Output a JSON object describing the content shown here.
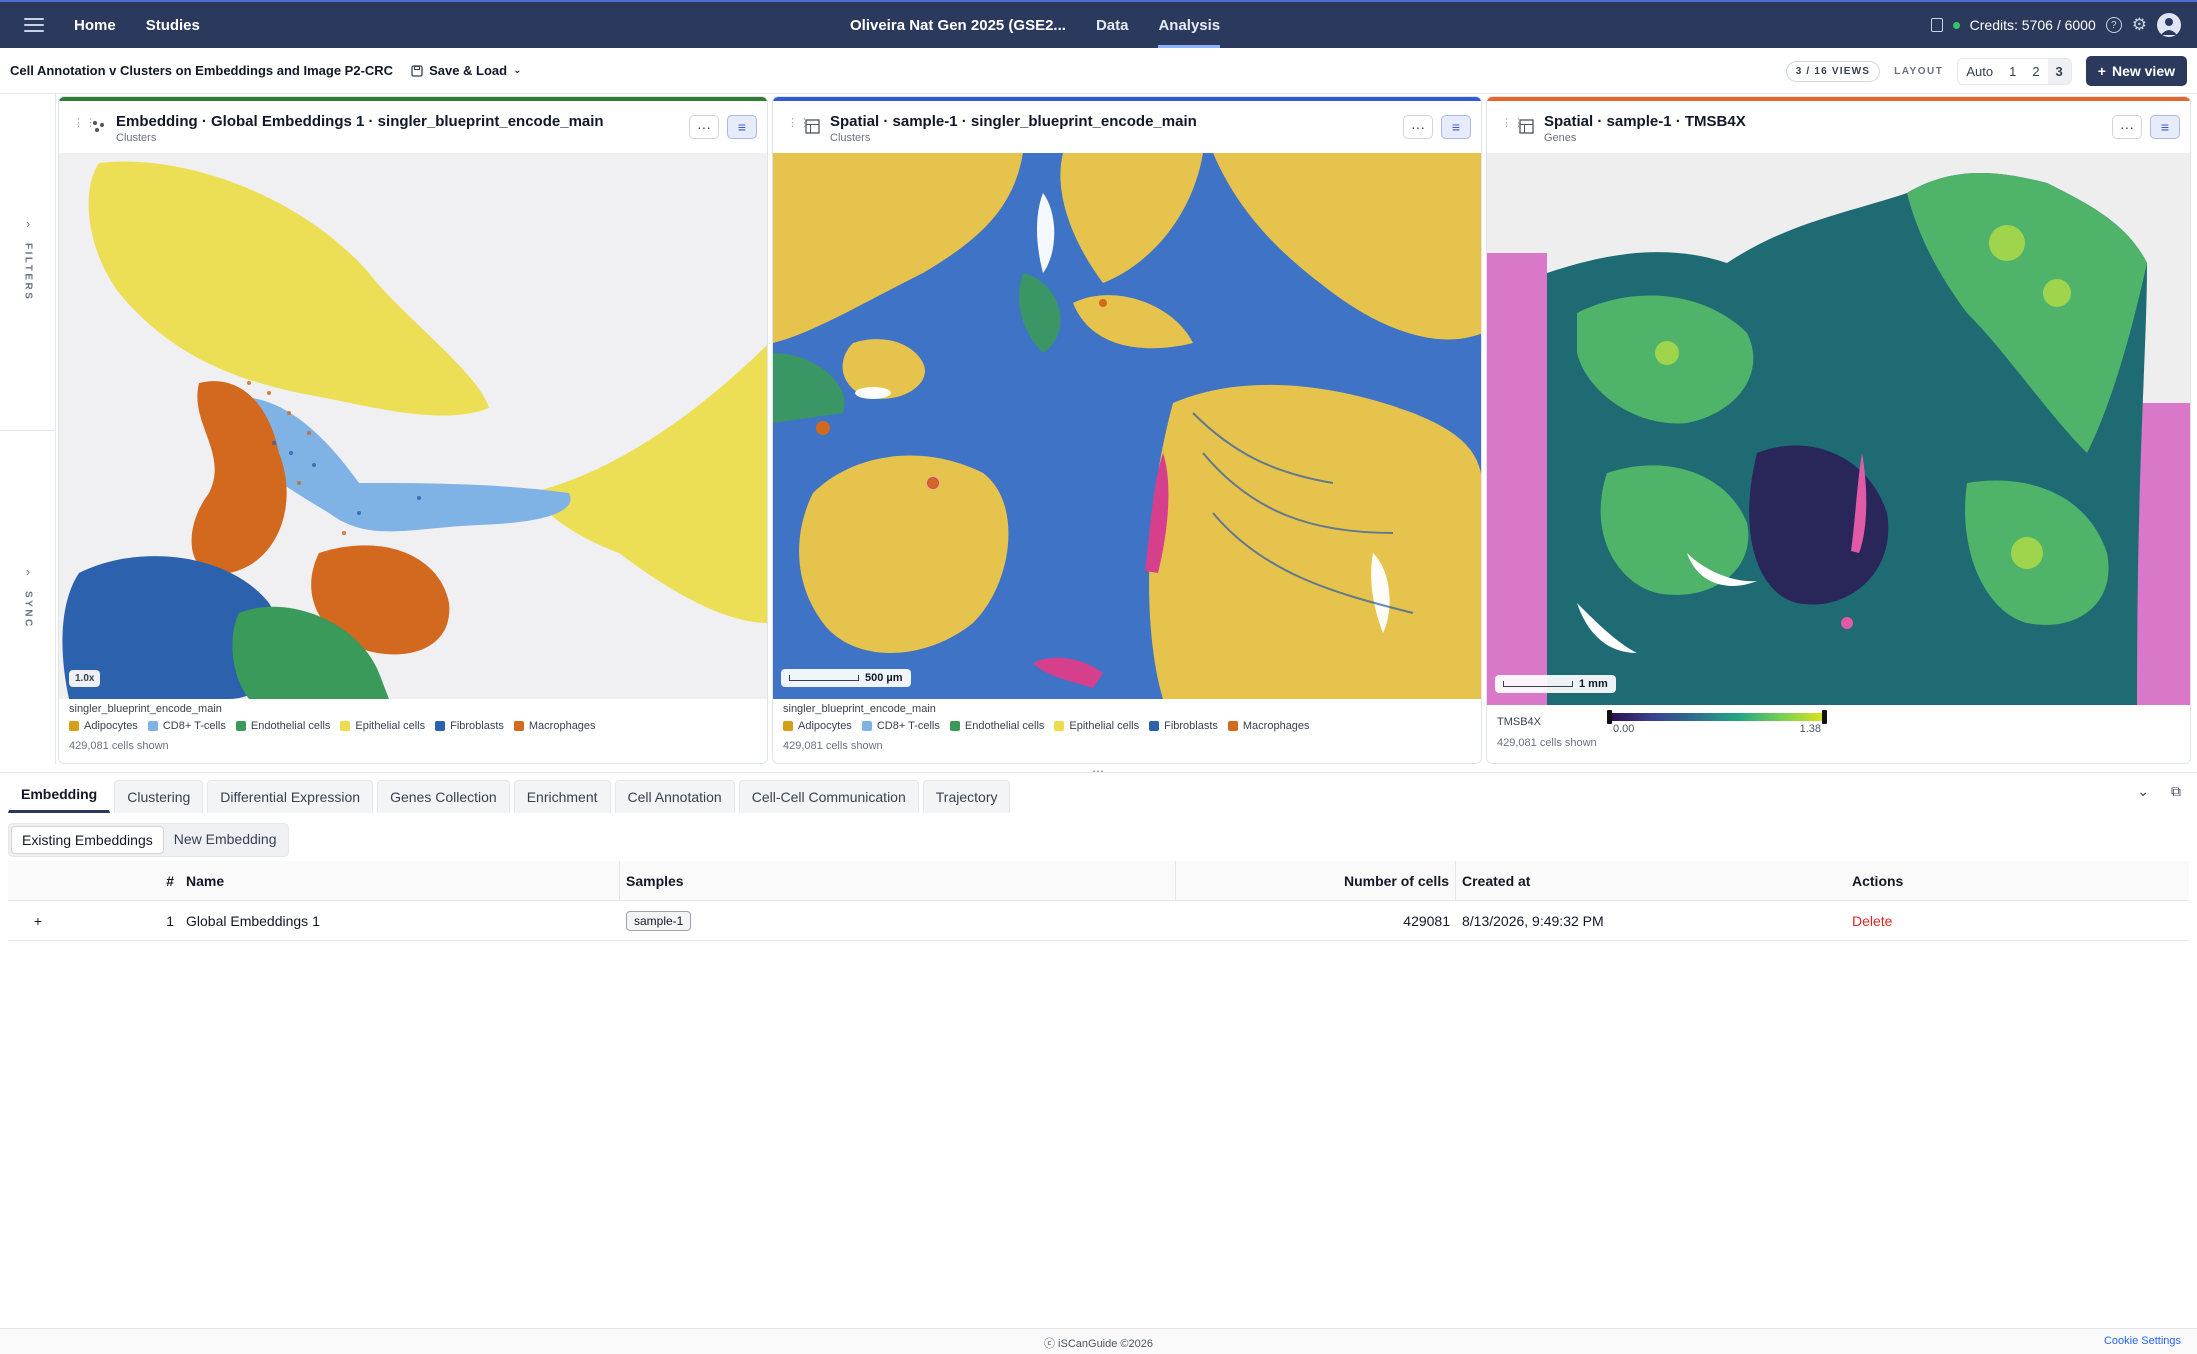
{
  "nav": {
    "home": "Home",
    "studies": "Studies",
    "study_title": "Oliveira Nat Gen 2025 (GSE2...",
    "data": "Data",
    "analysis": "Analysis",
    "credits": "Credits: 5706 / 6000"
  },
  "toolbar": {
    "title": "Cell Annotation v Clusters on Embeddings and Image P2-CRC",
    "save_load": "Save & Load",
    "views_badge": "3 / 16 VIEWS",
    "layout_label": "LAYOUT",
    "layout_options": [
      "Auto",
      "1",
      "2",
      "3"
    ],
    "layout_selected": "3",
    "new_view": "New view"
  },
  "rail": {
    "filters": "FILTERS",
    "sync": "SYNC"
  },
  "panels": [
    {
      "title": "Embedding · Global Embeddings 1 · singler_blueprint_encode_main",
      "subtitle": "Clusters",
      "accent": "#2e7d32",
      "zoom": "1.0x",
      "legend_title": "singler_blueprint_encode_main",
      "cells_shown": "429,081 cells shown"
    },
    {
      "title": "Spatial · sample-1 · singler_blueprint_encode_main",
      "subtitle": "Clusters",
      "accent": "#2f5bd3",
      "scale": "500 µm",
      "legend_title": "singler_blueprint_encode_main",
      "cells_shown": "429,081 cells shown"
    },
    {
      "title": "Spatial · sample-1 · TMSB4X",
      "subtitle": "Genes",
      "accent": "#e8662c",
      "scale": "1 mm",
      "gene": "TMSB4X",
      "cbar_min": "0.00",
      "cbar_max": "1.38",
      "cells_shown": "429,081 cells shown"
    }
  ],
  "legend": [
    {
      "label": "Adipocytes",
      "color": "#d4a017"
    },
    {
      "label": "CD8+ T-cells",
      "color": "#7fb3e6"
    },
    {
      "label": "Endothelial cells",
      "color": "#3a9a5a"
    },
    {
      "label": "Epithelial cells",
      "color": "#eddc4c"
    },
    {
      "label": "Fibroblasts",
      "color": "#2c62ad"
    },
    {
      "label": "Macrophages",
      "color": "#d2691e"
    }
  ],
  "tabs": [
    "Embedding",
    "Clustering",
    "Differential Expression",
    "Genes Collection",
    "Enrichment",
    "Cell Annotation",
    "Cell-Cell Communication",
    "Trajectory"
  ],
  "active_tab": "Embedding",
  "subtabs": [
    "Existing Embeddings",
    "New Embedding"
  ],
  "table": {
    "headers": {
      "num": "#",
      "name": "Name",
      "samples": "Samples",
      "cells": "Number of cells",
      "created": "Created at",
      "actions": "Actions"
    },
    "rows": [
      {
        "expand": "+",
        "num": "1",
        "name": "Global Embeddings 1",
        "sample": "sample-1",
        "cells": "429081",
        "created": "8/13/2026, 9:49:32 PM",
        "action": "Delete"
      }
    ]
  },
  "footer": {
    "copyright": "iSCanGuide ©2026",
    "cookie": "Cookie Settings"
  }
}
